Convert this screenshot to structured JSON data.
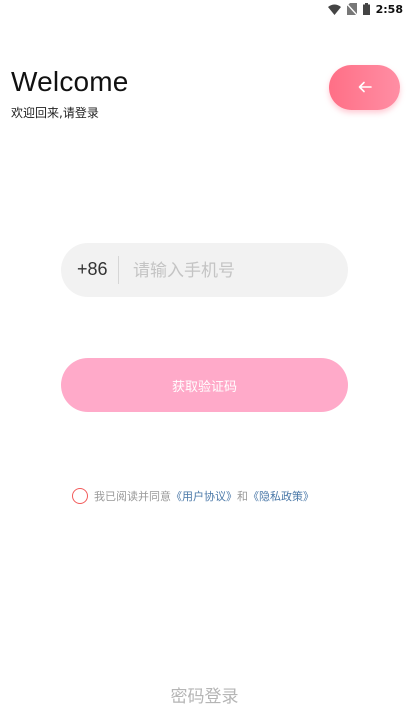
{
  "status_bar": {
    "time": "2:58"
  },
  "header": {
    "title": "Welcome",
    "subtitle": "欢迎回来,请登录"
  },
  "login": {
    "country_code": "+86",
    "phone_placeholder": "请输入手机号",
    "get_code_label": "获取验证码"
  },
  "agreement": {
    "prefix": "我已阅读并同意",
    "user_agreement": "《用户协议》",
    "conjunction": "和",
    "privacy_policy": "《隐私政策》"
  },
  "footer": {
    "password_login": "密码登录"
  },
  "colors": {
    "accent": "#ff7a92",
    "button": "#ffaac9",
    "link": "#4a78a8",
    "radio": "#f25c5c"
  },
  "icons": [
    "wifi-icon",
    "no-sim-icon",
    "battery-icon",
    "arrow-left-icon"
  ]
}
